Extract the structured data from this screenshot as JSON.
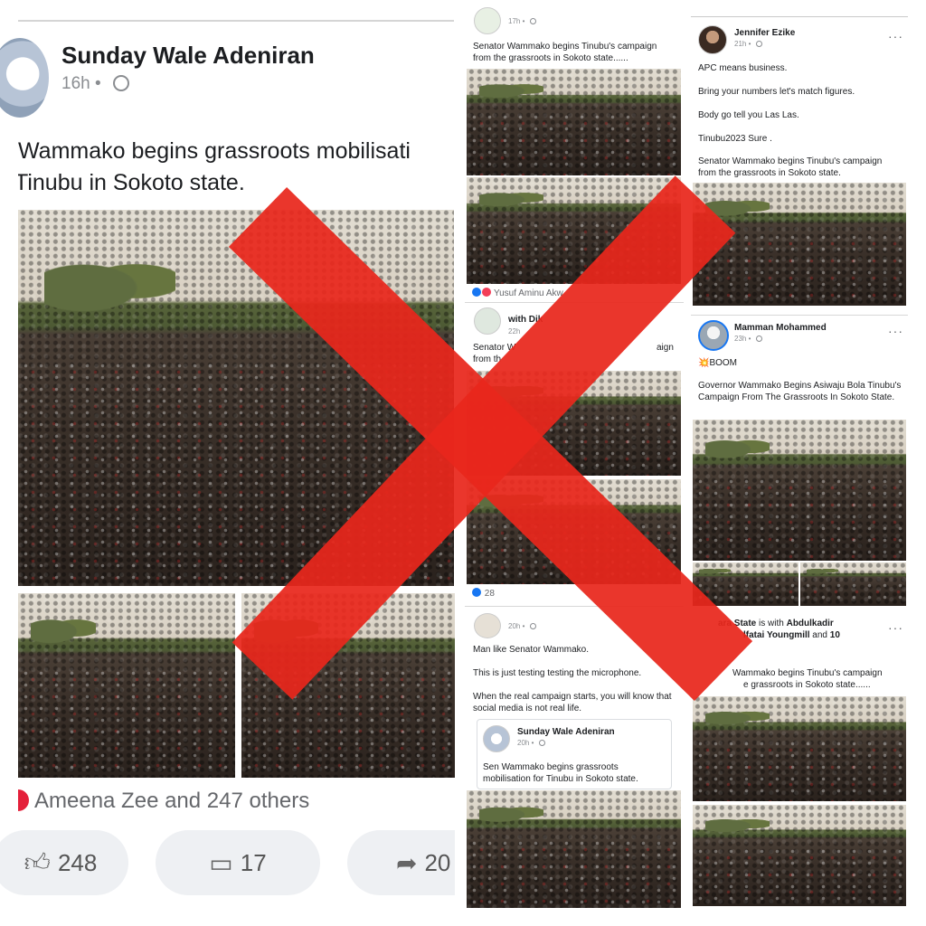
{
  "left_post": {
    "author": "Sunday Wale Adeniran",
    "time": "16h",
    "text_line1": "Wammako begins grassroots mobilisati",
    "text_line2": "Tinubu in Sokoto state.",
    "reactions_text": "Ameena Zee and 247 others",
    "like_count": "248",
    "comment_count": "17",
    "share_count": "20"
  },
  "middle_column": {
    "post1": {
      "time": "17h",
      "text": "Senator Wammako begins  Tinubu's campaign from the grassroots in Sokoto state......",
      "reactions_text": "Yusuf Aminu Akw"
    },
    "post2": {
      "header": "with Dik",
      "time": "22h",
      "text_line1": "Senator W",
      "text_line1_end": "aign",
      "text_line2": "from th",
      "like_count": "28"
    },
    "post3": {
      "time": "20h",
      "line1": "Man like Senator Wammako.",
      "line2": "This is just testing testing the microphone.",
      "line3": "When the real campaign starts, you will know that social media is not real life.",
      "quote_author": "Sunday Wale Adeniran",
      "quote_time": "20h",
      "quote_text": "Sen Wammako begins grassroots mobilisation for Tinubu in Sokoto state."
    }
  },
  "right_column": {
    "post1": {
      "author": "Jennifer Ezike",
      "time": "21h",
      "line1": "APC means business.",
      "line2": "Bring your numbers let's match figures.",
      "line3": "Body go tell you Las Las.",
      "line4": "Tinubu2023 Sure .",
      "line5": "Senator Wammako begins  Tinubu's campaign from the grassroots in Sokoto state."
    },
    "post2": {
      "author": "Mamman Mohammed",
      "time": "23h",
      "line1": "💥BOOM",
      "line2": "Governor Wammako Begins  Asiwaju Bola Tinubu's Campaign From The Grassroots In Sokoto State."
    },
    "post3": {
      "header_line1_a": "ara State",
      "header_line1_b": " is with ",
      "header_line1_c": "Abdulkadir",
      "header_line2_a": "lfatai Youngmill",
      "header_line2_b": " and ",
      "header_line2_c": "10",
      "text_start": "Wammako begins  Tinubu's campaign",
      "text_end": "e grassroots in Sokoto state......"
    }
  },
  "colors": {
    "overlay_x": "#e8271c",
    "text": "#1c1e21",
    "muted": "#8a8d91",
    "like_blue": "#1877f2"
  }
}
